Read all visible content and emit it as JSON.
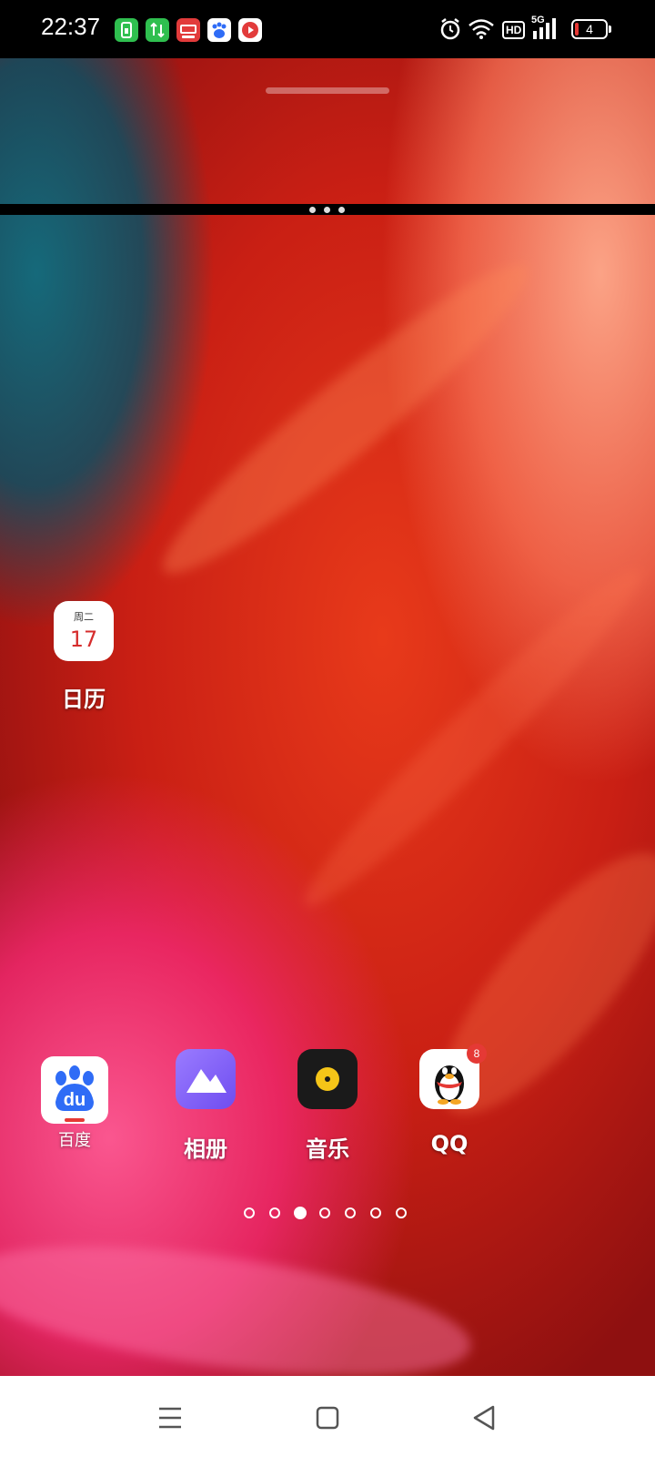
{
  "status_bar": {
    "time": "22:37",
    "notification_icons": [
      "sim-icon",
      "data-transfer-icon",
      "search-app-icon",
      "baidu-icon",
      "video-app-icon"
    ],
    "system_icons": [
      "alarm-icon",
      "wifi-icon",
      "hd-icon",
      "5g-signal-icon"
    ],
    "hd_label": "HD",
    "network_label": "5G",
    "battery_level": "4"
  },
  "home": {
    "calendar_widget": {
      "weekday": "周二",
      "day": "17",
      "label": "日历"
    },
    "dock_apps": [
      {
        "label": "百度",
        "icon": "baidu-paw-icon",
        "color": "#2f6cf6"
      },
      {
        "label": "相册",
        "icon": "mountain-icon",
        "color": "#7b5cff"
      },
      {
        "label": "音乐",
        "icon": "disc-icon",
        "color": "#f5c518"
      },
      {
        "label": "QQ",
        "icon": "penguin-icon",
        "badge": "8"
      }
    ],
    "page_count": 7,
    "current_page": 3
  },
  "nav_bar": {
    "buttons": [
      "menu-icon",
      "home-icon",
      "back-icon"
    ]
  },
  "colors": {
    "badge": "#e53935",
    "calendar_day": "#d62d2d"
  }
}
